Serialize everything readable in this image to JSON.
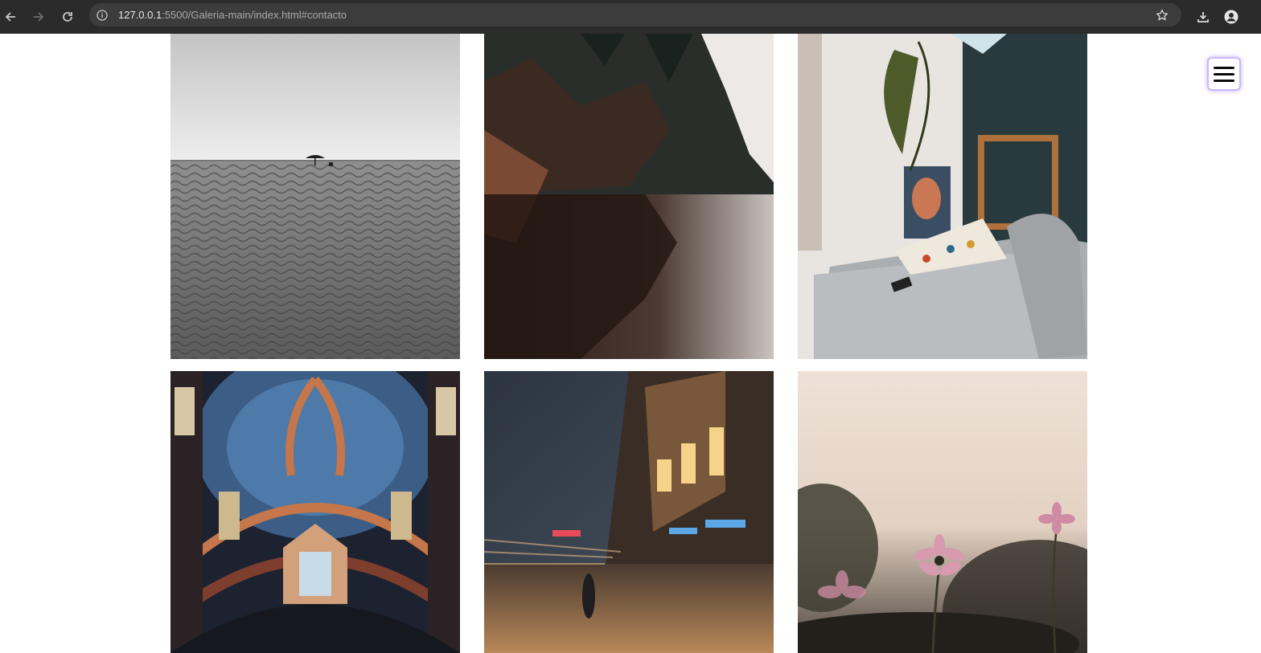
{
  "browser": {
    "url_host": "127.0.0.1",
    "url_rest": ":5500/Galeria-main/index.html#contacto",
    "icons": [
      "back-arrow-icon",
      "forward-arrow-icon",
      "reload-icon",
      "site-info-icon",
      "bookmark-star-icon",
      "download-icon",
      "profile-icon"
    ]
  },
  "gallery": {
    "photos": [
      {
        "subject": "black and white beach with umbrella"
      },
      {
        "subject": "forest lake reflection"
      },
      {
        "subject": "living room sofa with plant and paintings"
      },
      {
        "subject": "ornate baroque church ceiling"
      },
      {
        "subject": "motion-blurred night street"
      },
      {
        "subject": "pink cosmos flowers"
      }
    ]
  },
  "menu": {
    "icon": "hamburger-menu-icon"
  }
}
